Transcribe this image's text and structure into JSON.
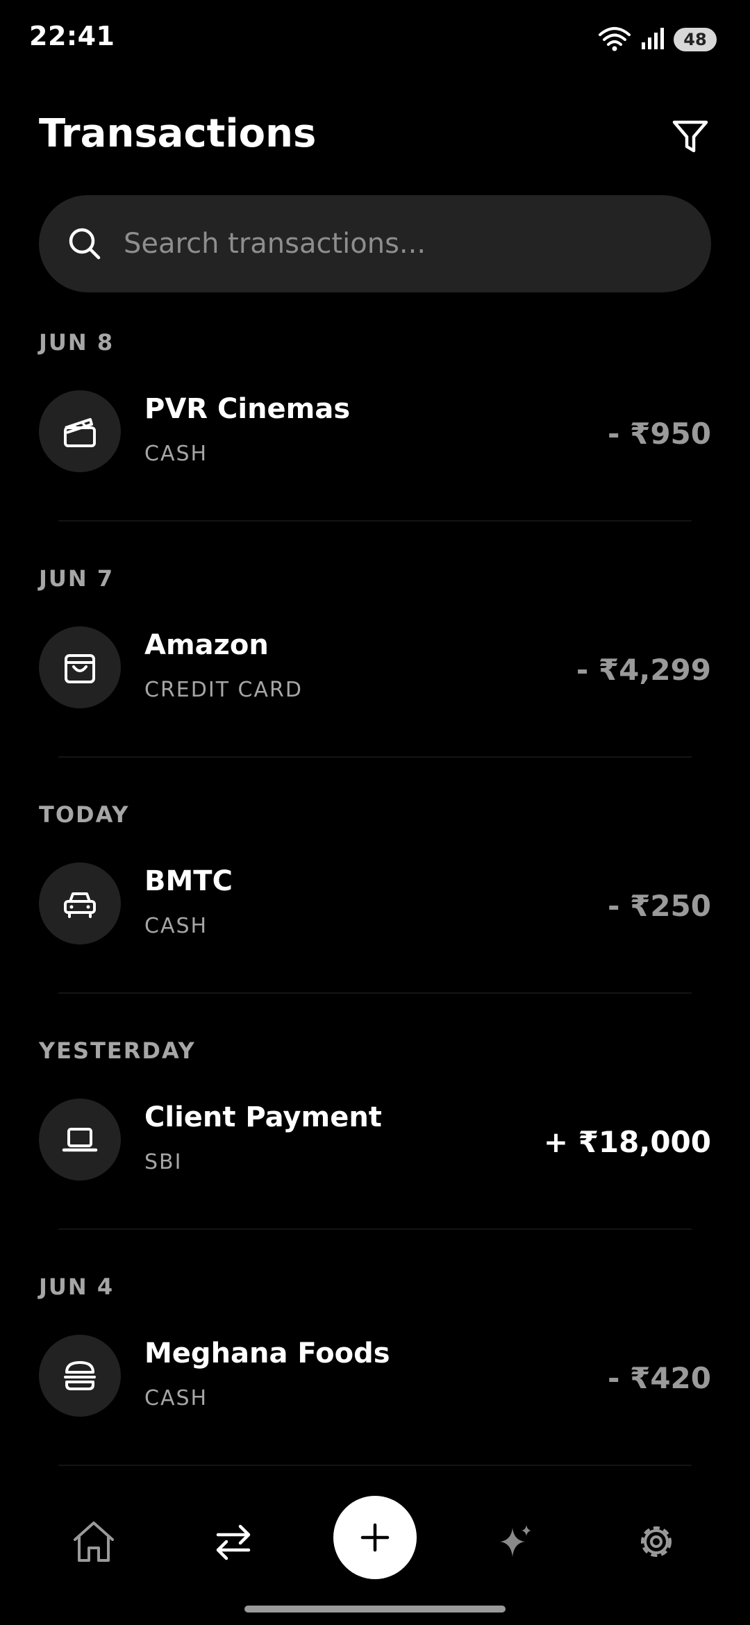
{
  "status_bar": {
    "time": "22:41",
    "battery": "48"
  },
  "header": {
    "title": "Transactions"
  },
  "search": {
    "placeholder": "Search transactions..."
  },
  "groups": [
    {
      "date": "JUN 8",
      "name": "PVR Cinemas",
      "account": "CASH",
      "amount": "- ₹950",
      "icon": "clapperboard-icon",
      "type": "expense"
    },
    {
      "date": "JUN 7",
      "name": "Amazon",
      "account": "CREDIT CARD",
      "amount": "- ₹4,299",
      "icon": "shopping-bag-icon",
      "type": "expense"
    },
    {
      "date": "TODAY",
      "name": "BMTC",
      "account": "CASH",
      "amount": "- ₹250",
      "icon": "car-icon",
      "type": "expense"
    },
    {
      "date": "YESTERDAY",
      "name": "Client Payment",
      "account": "SBI",
      "amount": "+ ₹18,000",
      "icon": "laptop-icon",
      "type": "income"
    },
    {
      "date": "JUN 4",
      "name": "Meghana Foods",
      "account": "CASH",
      "amount": "- ₹420",
      "icon": "burger-icon",
      "type": "expense"
    }
  ],
  "bottom_nav": {
    "items": [
      "home-icon",
      "transfer-arrows-icon",
      "add-icon",
      "sparkles-icon",
      "settings-gear-icon"
    ],
    "active": "transfer-arrows-icon"
  },
  "colors": {
    "background": "#000000",
    "surface": "#232323",
    "expense_amount": "#9a9a9a",
    "income_amount": "#ffffff",
    "muted_text": "#a6a6a6"
  }
}
